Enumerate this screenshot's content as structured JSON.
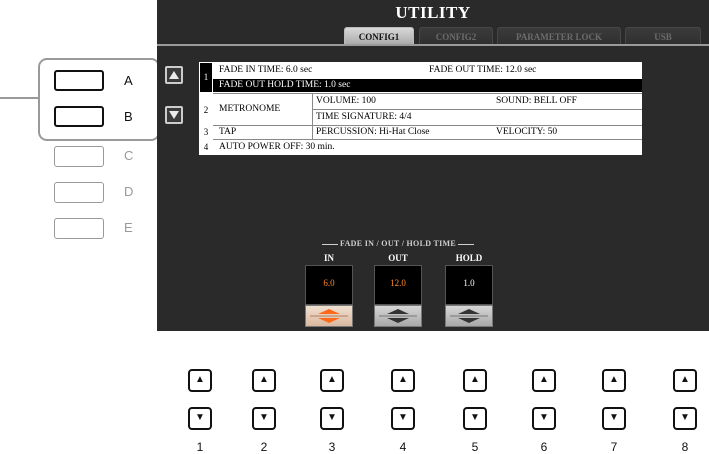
{
  "side_buttons": [
    {
      "label": "A",
      "active": true
    },
    {
      "label": "B",
      "active": true
    },
    {
      "label": "C",
      "active": false
    },
    {
      "label": "D",
      "active": false
    },
    {
      "label": "E",
      "active": false
    }
  ],
  "screen": {
    "title": "UTILITY",
    "tabs": [
      "CONFIG1",
      "CONFIG2",
      "PARAMETER LOCK",
      "USB"
    ],
    "active_tab": "CONFIG1",
    "rows": {
      "r1_num": "1",
      "r1a": "FADE IN TIME:  6.0 sec",
      "r1b": "FADE OUT TIME: 12.0 sec",
      "r1c": "FADE OUT HOLD TIME: 1.0 sec",
      "r2_num": "2",
      "r2_label": "METRONOME",
      "r2a": "VOLUME: 100",
      "r2b": "SOUND: BELL OFF",
      "r2c": "TIME SIGNATURE:   4/4",
      "r3_num": "3",
      "r3_label": "TAP",
      "r3a": "PERCUSSION: Hi-Hat Close",
      "r3b": "VELOCITY: 50",
      "r4_num": "4",
      "r4a": "AUTO POWER OFF:  30 min."
    },
    "params": {
      "title": "FADE IN / OUT / HOLD TIME",
      "items": [
        {
          "label": "IN",
          "value": "6.0"
        },
        {
          "label": "OUT",
          "value": "12.0"
        },
        {
          "label": "HOLD",
          "value": "1.0"
        }
      ]
    }
  },
  "bottom_buttons": {
    "up_glyph": "▲",
    "down_glyph": "▼",
    "labels": [
      "1",
      "2",
      "3",
      "4",
      "5",
      "6",
      "7",
      "8"
    ]
  },
  "colors": {
    "screen_bg": "#2a2a2a",
    "value_orange": "#ff8a2a",
    "value_white": "#ffffff",
    "callout_gray": "#9a9a9a"
  }
}
